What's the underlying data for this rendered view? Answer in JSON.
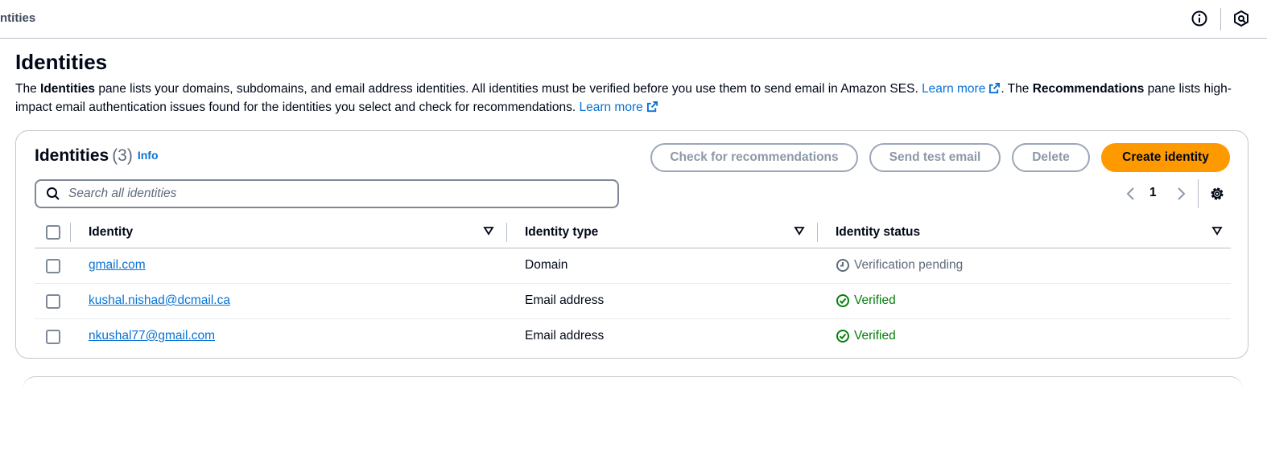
{
  "topbar": {
    "breadcrumb": "ntities",
    "info_icon": "info-circle-icon",
    "panel_icon": "help-panel-icon"
  },
  "page": {
    "title": "Identities",
    "desc": {
      "p1_pre": "The ",
      "p1_bold": "Identities",
      "p1_post": " pane lists your domains, subdomains, and email address identities. All identities must be verified before you use them to send email in Amazon SES. ",
      "learn_more_1": "Learn more",
      "p2_pre": ". The ",
      "p2_bold": "Recommendations",
      "p2_post": " pane lists high-impact email authentication issues found for the identities you select and check for recommendations. ",
      "learn_more_2": "Learn more"
    }
  },
  "card": {
    "title": "Identities",
    "count": "(3)",
    "info": "Info",
    "buttons": {
      "check": "Check for recommendations",
      "send_test": "Send test email",
      "delete": "Delete",
      "create": "Create identity"
    },
    "search": {
      "placeholder": "Search all identities"
    },
    "pager": {
      "page": "1"
    },
    "columns": {
      "identity": "Identity",
      "type": "Identity type",
      "status": "Identity status"
    },
    "rows": [
      {
        "identity": "gmail.com",
        "type": "Domain",
        "status": "Verification pending",
        "status_kind": "pending"
      },
      {
        "identity": "kushal.nishad@dcmail.ca",
        "type": "Email address",
        "status": "Verified",
        "status_kind": "verified"
      },
      {
        "identity": "nkushal77@gmail.com",
        "type": "Email address",
        "status": "Verified",
        "status_kind": "verified"
      }
    ]
  },
  "colors": {
    "accent": "#ff9900",
    "link": "#0972d3",
    "success": "#037f0c",
    "muted": "#5f6b7a"
  }
}
